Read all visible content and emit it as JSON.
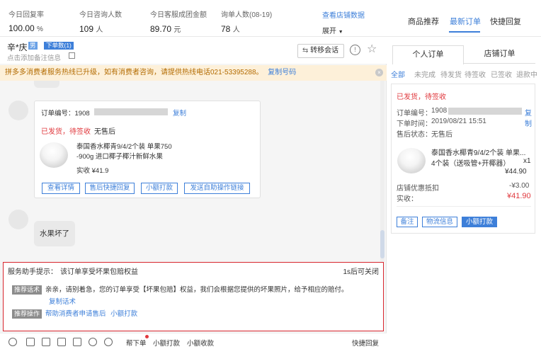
{
  "stats": [
    {
      "label": "今日回复率",
      "value": "100.00",
      "unit": "%"
    },
    {
      "label": "今日咨询人数",
      "value": "109",
      "unit": "人"
    },
    {
      "label": "今日客服成团金额",
      "value": "89.70",
      "unit": "元"
    },
    {
      "label": "询单人数(08-19)",
      "value": "78",
      "unit": "人"
    }
  ],
  "stats_link": "查看店铺数据",
  "expand": "展开",
  "customer": {
    "name": "辛*庆",
    "gender": "男",
    "badge": "下单数(1)",
    "note": "点击添加备注信息"
  },
  "transfer": "转移会话",
  "notice": {
    "text": "拼多多消费者服务热线已升级，如有消费者咨询，请提供热线电话021-53395288。",
    "link": "复制号码"
  },
  "order_card": {
    "order_label": "订单编号：1908",
    "copy": "复制",
    "status": "已发货，待签收",
    "after_sale": "无售后",
    "title_line1": "泰国香水椰青9/4/2个装 单果750",
    "title_line2": "-900g 进口椰子椰汁新鲜水果",
    "paid": "实收 ¥41.9",
    "buttons": [
      "查看详情",
      "售后快捷回复",
      "小额打款",
      "发送自助操作链接"
    ]
  },
  "message": "水果坏了",
  "assistant": {
    "title": "服务助手提示：",
    "subtitle": "该订单享受坏果包赔权益",
    "close": "1s后可关闭",
    "tag1": "推荐话术",
    "script": "亲亲，请别着急，您的订单享受【坏果包赔】权益，我们会根据您提供的坏果照片，给予相应的赔付。",
    "copy": "复制话术",
    "tag2": "推荐操作",
    "op1": "帮助消费者申请售后",
    "op2": "小额打款"
  },
  "toolbar": {
    "order": "帮下单",
    "pay": "小额打款",
    "collect": "小额收款",
    "quick": "快捷回复"
  },
  "right_tabs": [
    "商品推荐",
    "最新订单",
    "快捷回复"
  ],
  "sub_tabs": [
    "个人订单",
    "店铺订单"
  ],
  "filters": [
    "全部",
    "未完成",
    "待发货",
    "待签收",
    "已签收",
    "退款中"
  ],
  "order": {
    "status": "已发货，待签收",
    "no_label": "订单编号：",
    "no": "1908",
    "copy": "复制",
    "time_label": "下单时间：",
    "time": "2019/08/21 15:51",
    "after_label": "售后状态：",
    "after": "无售后",
    "title1": "泰国香水椰青9/4/2个装 单果...",
    "title2": "4个装（送吸管+开椰器）",
    "qty": "x1",
    "price": "¥44.90",
    "discount_label": "店铺优惠抵扣",
    "discount": "-¥3.00",
    "paid_label": "实收：",
    "paid": "¥41.90",
    "buttons": [
      "备注",
      "物流信息",
      "小额打款"
    ]
  },
  "colors": {
    "accent": "#3d7fd9",
    "red": "#e0393e",
    "notice_bg": "#fdf0d9",
    "border_red": "#d8252d"
  }
}
